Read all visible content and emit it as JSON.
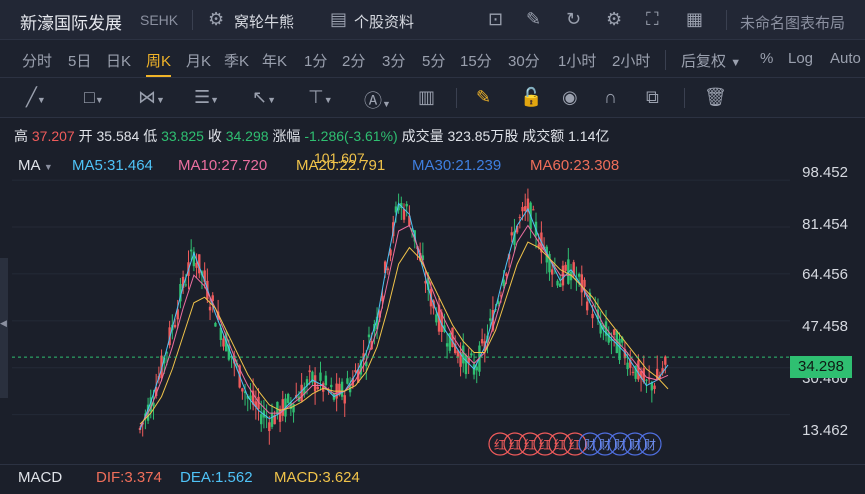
{
  "header": {
    "stock_name": "新濠国际发展",
    "market": "SEHK",
    "link1": "窝轮牛熊",
    "link2": "个股资料",
    "layout_name": "未命名图表布局"
  },
  "periods": [
    "分时",
    "5日",
    "日K",
    "周K",
    "月K",
    "季K",
    "年K",
    "1分",
    "2分",
    "3分",
    "5分",
    "15分",
    "30分",
    "1小时",
    "2小时"
  ],
  "active_period": "周K",
  "right_controls": {
    "adjust": "后复权",
    "percent": "%",
    "log": "Log",
    "auto": "Auto"
  },
  "quote": {
    "high_label": "高",
    "high": "37.207",
    "open_label": "开",
    "open": "35.584",
    "low_label": "低",
    "low": "33.825",
    "close_label": "收",
    "close": "34.298",
    "change_label": "涨幅",
    "change": "-1.286(-3.61%)",
    "volume_label": "成交量",
    "volume": "323.85万股",
    "amount_label": "成交额",
    "amount": "1.14亿"
  },
  "ma": {
    "label": "MA",
    "ma5": "MA5:31.464",
    "ma10": "MA10:27.720",
    "ma20": "MA20:22.791",
    "ma30": "MA30:21.239",
    "ma60": "MA60:23.308"
  },
  "peak_label": "101.607",
  "y_axis": [
    "98.452",
    "81.454",
    "64.456",
    "47.458",
    "30.460",
    "13.462"
  ],
  "current_price": "34.298",
  "macd": {
    "label": "MACD",
    "dif": "DIF:3.374",
    "dea": "DEA:1.562",
    "macd": "MACD:3.624"
  },
  "event_badges": [
    "红",
    "红",
    "红",
    "红",
    "红",
    "红",
    "财",
    "财",
    "财",
    "财",
    "财"
  ],
  "colors": {
    "up": "#ef5b5b",
    "down": "#2fbf71",
    "ma5": "#4fc3f7",
    "ma10": "#ec6fa0",
    "ma20": "#f0c34a",
    "ma30": "#3f7fe0",
    "ma60": "#ef6e5a",
    "accent": "#f0b429"
  },
  "chart_data": {
    "type": "line",
    "title": "",
    "ylim": [
      5,
      105
    ],
    "series": [
      {
        "name": "MA5",
        "values": [
          8,
          18,
          30,
          45,
          60,
          72,
          62,
          50,
          40,
          30,
          20,
          15,
          12,
          14,
          18,
          22,
          26,
          24,
          20,
          22,
          28,
          36,
          48,
          70,
          90,
          86,
          70,
          56,
          46,
          40,
          34,
          30,
          38,
          52,
          68,
          82,
          88,
          78,
          70,
          62,
          66,
          60,
          52,
          44,
          40,
          36,
          30,
          24,
          26,
          31.464
        ]
      },
      {
        "name": "MA10",
        "values": [
          9,
          16,
          26,
          38,
          52,
          64,
          60,
          52,
          42,
          32,
          24,
          18,
          14,
          14,
          17,
          20,
          24,
          24,
          21,
          22,
          26,
          33,
          44,
          62,
          80,
          82,
          72,
          60,
          50,
          42,
          36,
          32,
          36,
          48,
          62,
          76,
          82,
          76,
          70,
          64,
          64,
          60,
          54,
          46,
          41,
          37,
          32,
          27,
          26,
          27.72
        ]
      },
      {
        "name": "MA20",
        "values": [
          10,
          14,
          20,
          30,
          42,
          54,
          56,
          52,
          44,
          36,
          28,
          22,
          17,
          15,
          16,
          18,
          21,
          23,
          22,
          22,
          24,
          29,
          38,
          52,
          68,
          74,
          70,
          62,
          54,
          46,
          40,
          36,
          36,
          44,
          56,
          68,
          76,
          74,
          70,
          66,
          64,
          60,
          56,
          50,
          45,
          40,
          35,
          30,
          27,
          22.791
        ]
      }
    ]
  }
}
